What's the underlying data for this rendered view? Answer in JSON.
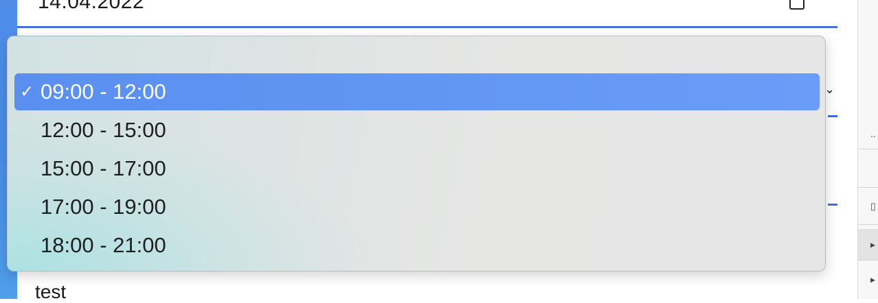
{
  "form": {
    "date_value": "14.04.2022",
    "below_text": "test"
  },
  "dropdown": {
    "options": [
      {
        "label": "09:00 - 12:00",
        "selected": true
      },
      {
        "label": "12:00 - 15:00",
        "selected": false
      },
      {
        "label": "15:00 - 17:00",
        "selected": false
      },
      {
        "label": "17:00 - 19:00",
        "selected": false
      },
      {
        "label": "18:00 - 21:00",
        "selected": false
      }
    ],
    "check_glyph": "✓"
  },
  "side_panel": {
    "rows": [
      "..",
      "",
      "▯",
      "▸",
      "▸"
    ]
  },
  "icons": {
    "calendar": "calendar-icon",
    "chevron": "chevron-down-icon"
  },
  "colors": {
    "accent": "#3f6fe0",
    "selected_bg": "#6297f2",
    "left_stripe": "#4a90e8"
  }
}
